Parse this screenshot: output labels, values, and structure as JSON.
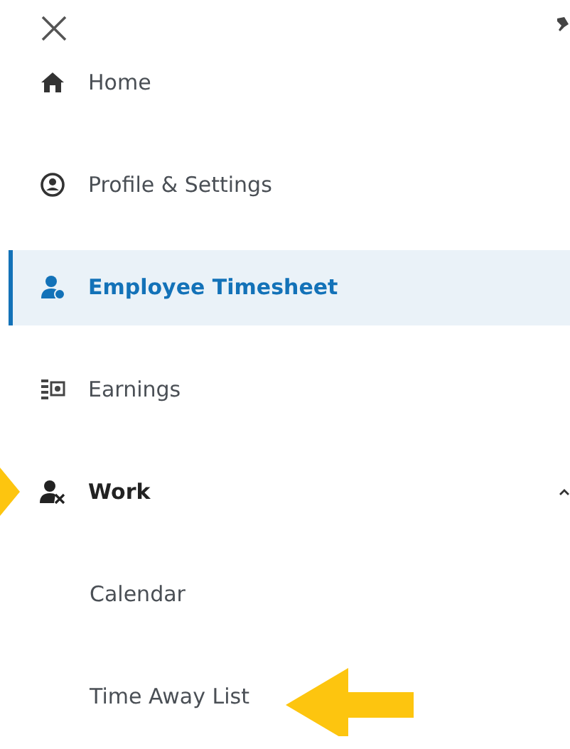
{
  "menu": {
    "items": [
      {
        "label": "Home",
        "selected": false,
        "callout": false
      },
      {
        "label": "Profile & Settings",
        "selected": false,
        "callout": false
      },
      {
        "label": "Employee Timesheet",
        "selected": true,
        "callout": false
      },
      {
        "label": "Earnings",
        "selected": false,
        "callout": false
      },
      {
        "label": "Work",
        "selected": false,
        "callout": true,
        "expanded": true,
        "children": [
          {
            "label": "Calendar",
            "selected": false,
            "callout": false
          },
          {
            "label": "Time Away List",
            "selected": false,
            "callout": true
          }
        ]
      }
    ]
  }
}
